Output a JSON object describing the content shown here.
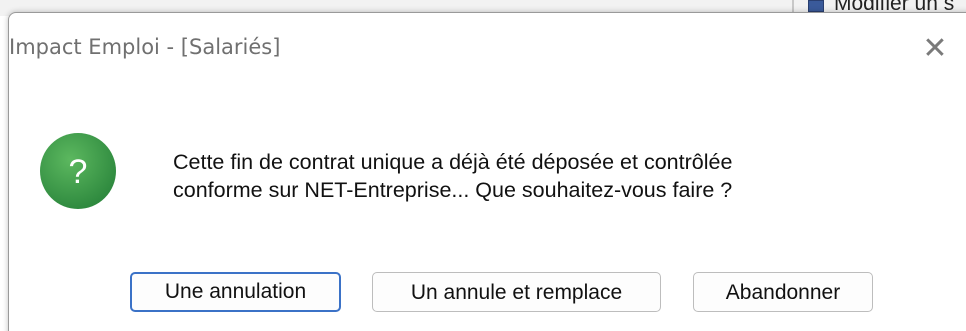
{
  "background_window": {
    "peek_text": "Modifier un s"
  },
  "dialog": {
    "title": "Impact Emploi - [Salariés]",
    "close_glyph": "✕",
    "icon": "question-icon",
    "icon_glyph": "?",
    "icon_color": "#3d9a4a",
    "message_line1": "Cette fin de contrat unique a déjà été déposée et contrôlée",
    "message_line2": "conforme sur NET-Entreprise... Que souhaitez-vous faire ?",
    "buttons": {
      "cancel_label": "Une annulation",
      "replace_label": "Un annule et remplace",
      "abandon_label": "Abandonner"
    },
    "accent_color": "#3b72c7"
  }
}
